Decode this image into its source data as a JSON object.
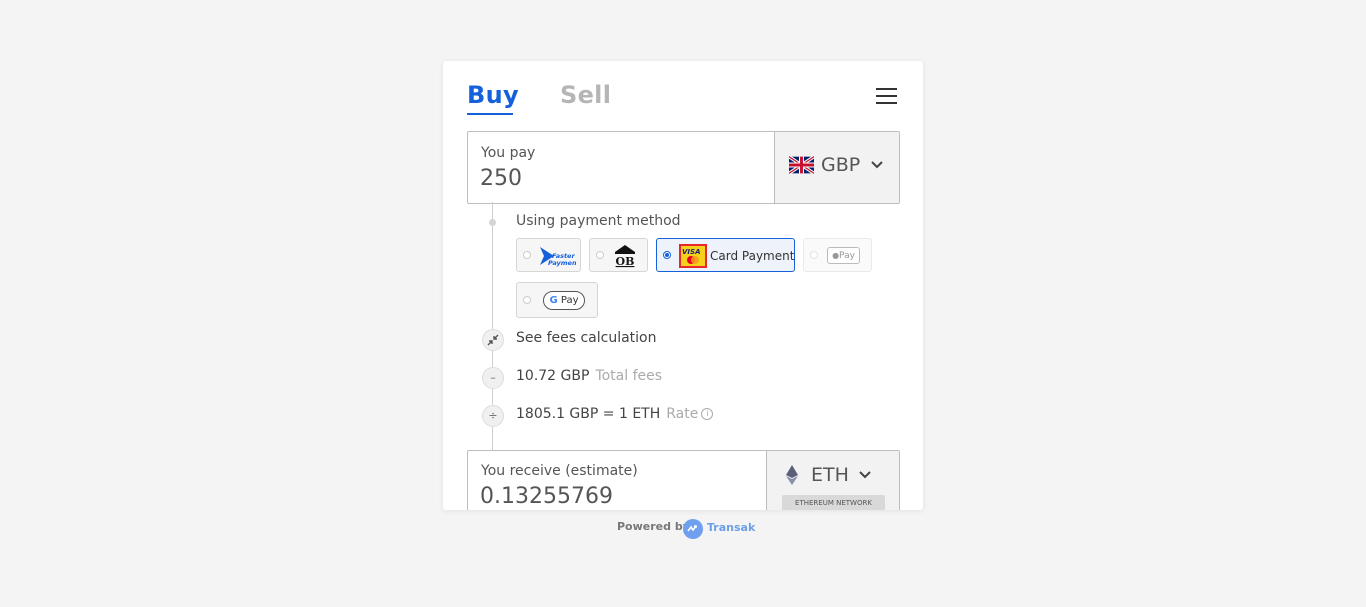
{
  "tabs": {
    "buy": "Buy",
    "sell": "Sell"
  },
  "pay": {
    "label": "You pay",
    "amount": "250",
    "currency": "GBP",
    "flag_icon": "uk-flag-icon"
  },
  "payment_method": {
    "title": "Using payment method",
    "options": [
      {
        "id": "faster-payments",
        "label": "",
        "logo_text": [
          "Faster",
          "Payments"
        ],
        "selected": false
      },
      {
        "id": "open-banking",
        "label": "",
        "logo_text": "OB",
        "selected": false
      },
      {
        "id": "card-payment",
        "label": "Card Payment",
        "logo_text": "VISA",
        "selected": true
      },
      {
        "id": "apple-pay",
        "label": "",
        "logo_text": "Pay",
        "selected": false,
        "disabled": true
      },
      {
        "id": "google-pay",
        "label": "",
        "logo_text": "Pay",
        "selected": false
      }
    ]
  },
  "fees": {
    "see_calc": "See fees calculation",
    "total_amount": "10.72 GBP",
    "total_label": "Total fees",
    "rate_value": "1805.1 GBP = 1 ETH",
    "rate_label": "Rate"
  },
  "receive": {
    "label": "You receive (estimate)",
    "amount": "0.13255769",
    "currency": "ETH",
    "network": "ETHEREUM NETWORK"
  },
  "footer": {
    "powered_by": "Powered by",
    "brand": "Transak"
  },
  "colors": {
    "accent": "#1461db",
    "muted": "#b5b5b5",
    "background": "#f4f4f4"
  }
}
